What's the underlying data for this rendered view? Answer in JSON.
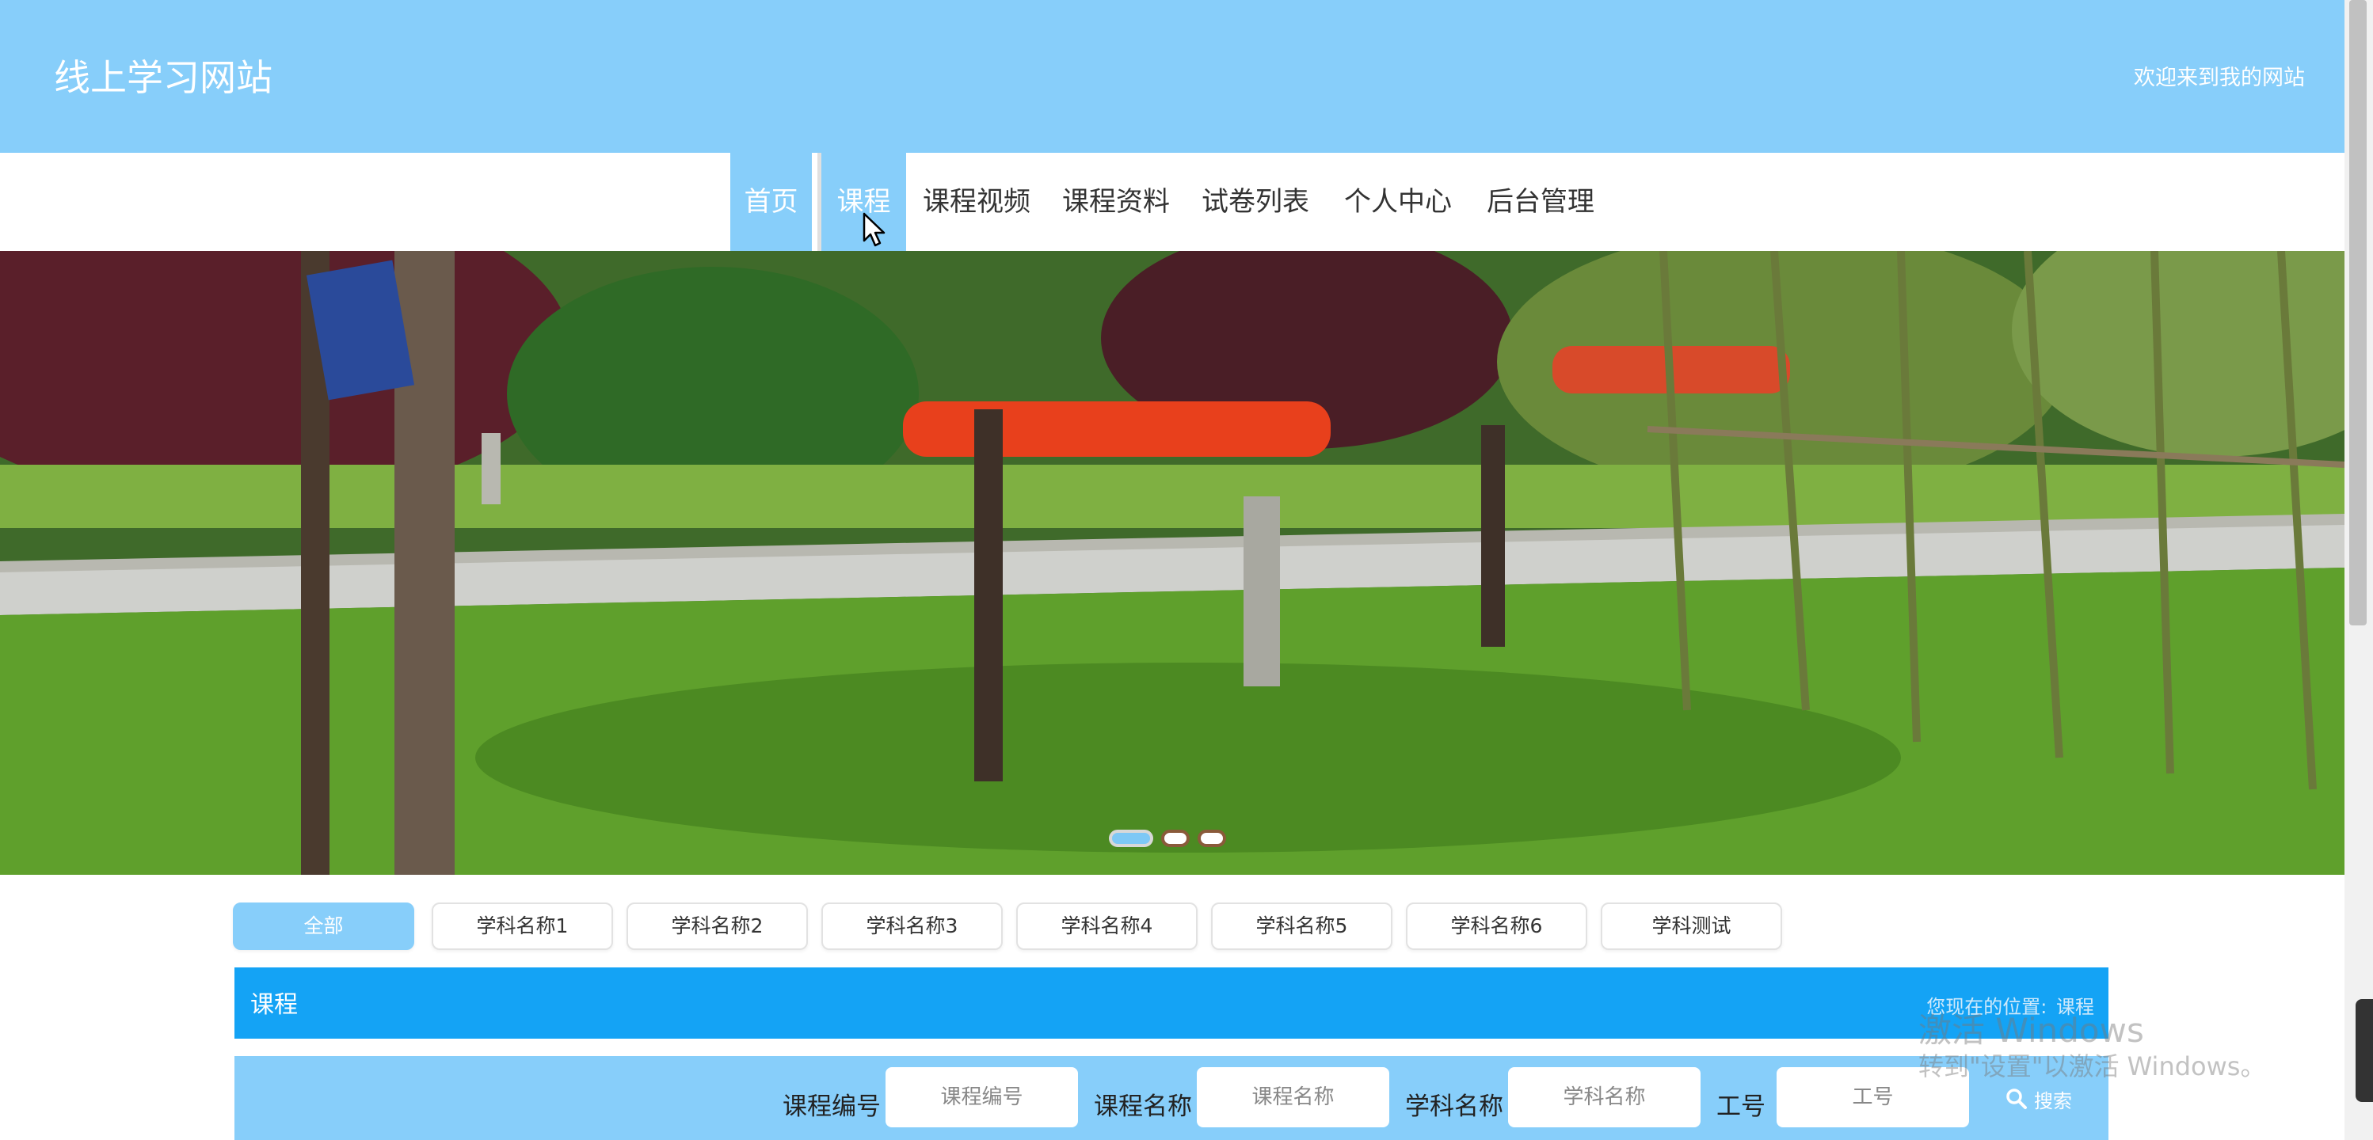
{
  "header": {
    "site_title": "线上学习网站",
    "welcome": "欢迎来到我的网站"
  },
  "nav": {
    "items": [
      {
        "label": "首页",
        "active": true
      },
      {
        "label": "课程",
        "active": false
      },
      {
        "label": "课程视频",
        "active": false
      },
      {
        "label": "课程资料",
        "active": false
      },
      {
        "label": "试卷列表",
        "active": false
      },
      {
        "label": "个人中心",
        "active": false
      },
      {
        "label": "后台管理",
        "active": false
      }
    ]
  },
  "banner": {
    "slide_count": 3,
    "active_slide": 1
  },
  "categories": [
    {
      "label": "全部",
      "active": true
    },
    {
      "label": "学科名称1",
      "active": false
    },
    {
      "label": "学科名称2",
      "active": false
    },
    {
      "label": "学科名称3",
      "active": false
    },
    {
      "label": "学科名称4",
      "active": false
    },
    {
      "label": "学科名称5",
      "active": false
    },
    {
      "label": "学科名称6",
      "active": false
    },
    {
      "label": "学科测试",
      "active": false
    }
  ],
  "section": {
    "title": "课程",
    "location_label": "您现在的位置:",
    "location_value": "课程"
  },
  "search": {
    "fields": [
      {
        "label": "课程编号",
        "placeholder": "课程编号"
      },
      {
        "label": "课程名称",
        "placeholder": "课程名称"
      },
      {
        "label": "学科名称",
        "placeholder": "学科名称"
      },
      {
        "label": "工号",
        "placeholder": "工号"
      }
    ],
    "button_label": "搜索"
  },
  "watermark": {
    "line1": "激活 Windows",
    "line2": "转到\"设置\"以激活 Windows。"
  },
  "colors": {
    "header_bg": "#87cefa",
    "section_bar": "#14a3f5",
    "active_chip": "#87cefa"
  }
}
